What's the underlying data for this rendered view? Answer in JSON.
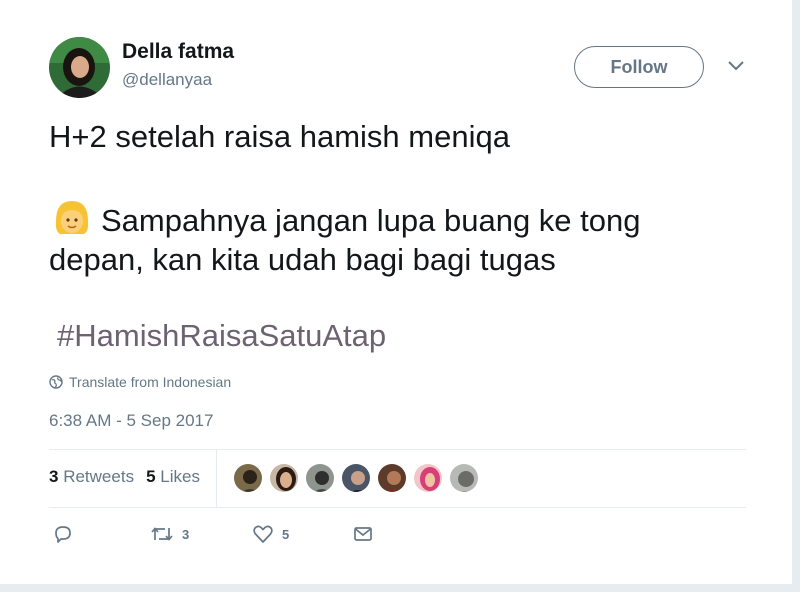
{
  "author": {
    "name": "Della fatma",
    "handle": "@dellanyaa"
  },
  "header": {
    "follow_label": "Follow",
    "caret_icon": "chevron-down-icon"
  },
  "tweet": {
    "line1": "H+2 setelah raisa hamish meniqa",
    "line2": "Sampahnya jangan lupa buang ke tong",
    "line3": "depan, kan kita udah bagi bagi tugas",
    "emoji": "person-blond-hair-emoji",
    "hashtag": "#HamishRaisaSatuAtap"
  },
  "translate_label": "Translate from Indonesian",
  "timestamp": "6:38 AM - 5 Sep 2017",
  "stats": {
    "retweets_count": "3",
    "retweets_label": "Retweets",
    "likes_count": "5",
    "likes_label": "Likes"
  },
  "likers_count": 7,
  "actions": {
    "reply_icon": "reply-icon",
    "retweet_icon": "retweet-icon",
    "retweet_count": "3",
    "like_icon": "heart-icon",
    "like_count": "5",
    "dm_icon": "envelope-icon"
  },
  "colors": {
    "text": "#14171a",
    "secondary": "#657786",
    "hashtag": "#6c6271",
    "divider": "#e6ecf0"
  }
}
